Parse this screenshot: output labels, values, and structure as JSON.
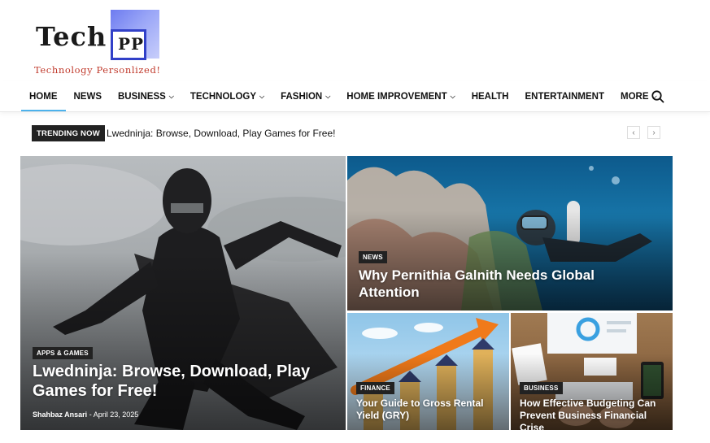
{
  "logo": {
    "word": "Tech",
    "box_text": "PP",
    "tagline": "Technology Personlized!"
  },
  "nav": {
    "items": [
      {
        "label": "HOME",
        "dropdown": false,
        "active": true
      },
      {
        "label": "NEWS",
        "dropdown": false
      },
      {
        "label": "BUSINESS",
        "dropdown": true
      },
      {
        "label": "TECHNOLOGY",
        "dropdown": true
      },
      {
        "label": "FASHION",
        "dropdown": true
      },
      {
        "label": "HOME IMPROVEMENT",
        "dropdown": true
      },
      {
        "label": "HEALTH",
        "dropdown": false
      },
      {
        "label": "ENTERTAINMENT",
        "dropdown": false
      },
      {
        "label": "MORE",
        "dropdown": true
      }
    ],
    "search_icon": "search-icon"
  },
  "trending": {
    "label": "TRENDING NOW",
    "headline": "Lwedninja: Browse, Download, Play Games for Free!",
    "prev": "‹",
    "next": "›"
  },
  "cards": {
    "main": {
      "category": "APPS & GAMES",
      "title": "Lwedninja: Browse, Download, Play Games for Free!",
      "author": "Shahbaz Ansari",
      "separator": "-",
      "date": "April 23, 2025"
    },
    "top_right": {
      "category": "NEWS",
      "title": "Why Pernithia Galnith Needs Global Attention"
    },
    "bottom_left": {
      "category": "FINANCE",
      "title": "Your Guide to Gross Rental Yield (GRY)"
    },
    "bottom_right": {
      "category": "BUSINESS",
      "title": "How Effective Budgeting Can Prevent Business Financial Crise"
    }
  },
  "colors": {
    "accent": "#4db2ec",
    "badge": "#222222",
    "tagline": "#c0392b",
    "logo_blue": "#3140c8"
  }
}
